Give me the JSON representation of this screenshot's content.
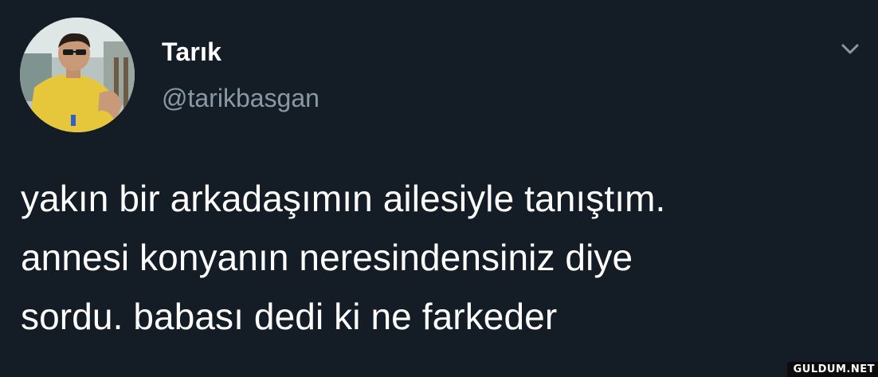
{
  "tweet": {
    "display_name": "Tarık",
    "handle": "@tarikbasgan",
    "text": "yakın bir arkadaşımın ailesiyle tanıştım.\nannesi konyanın neresindensiniz diye\nsordu. babası dedi ki ne farkeder",
    "menu_icon": "chevron-down-icon",
    "avatar_icon": "profile-photo"
  },
  "watermark": {
    "label": "GULDUM.NET"
  },
  "colors": {
    "background": "#141d26",
    "primary_text": "#ffffff",
    "secondary_text": "#8899a6"
  }
}
